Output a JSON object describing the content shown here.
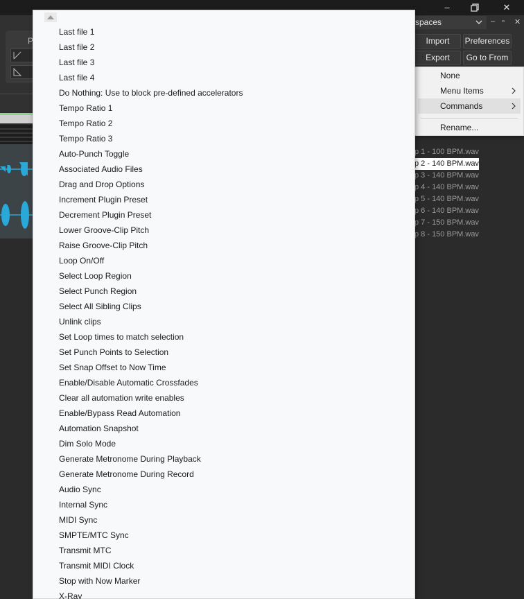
{
  "window": {
    "workspace_label": "spaces",
    "minimize_glyph": "–",
    "maximize_glyph": "❐",
    "close_glyph": "✕",
    "mini_controls": [
      "–",
      "▫",
      "✕"
    ]
  },
  "left_panel": {
    "label": "P"
  },
  "toolbar": {
    "import_label": "Import",
    "preferences_label": "Preferences",
    "export_label": "Export",
    "goto_label": "Go to From"
  },
  "files": [
    {
      "label": "p 1 - 100 BPM.wav",
      "selected": false
    },
    {
      "label": "p 2 - 140 BPM.wav",
      "selected": true
    },
    {
      "label": "p 3 - 140 BPM.wav",
      "selected": false
    },
    {
      "label": "p 4 - 140 BPM.wav",
      "selected": false
    },
    {
      "label": "p 5 - 140 BPM.wav",
      "selected": false
    },
    {
      "label": "p 6 - 140 BPM.wav",
      "selected": false
    },
    {
      "label": "p 7 - 150 BPM.wav",
      "selected": false
    },
    {
      "label": "p 8 - 150 BPM.wav",
      "selected": false
    }
  ],
  "submenu": {
    "items": [
      {
        "label": "None",
        "has_arrow": false,
        "highlighted": false
      },
      {
        "label": "Menu Items",
        "has_arrow": true,
        "highlighted": false
      },
      {
        "label": "Commands",
        "has_arrow": true,
        "highlighted": true
      }
    ],
    "rename_label": "Rename..."
  },
  "menu": {
    "scroll_icon": "scroll-up-arrow",
    "items": [
      "Last file 1",
      "Last file 2",
      "Last file 3",
      "Last file 4",
      "Do Nothing: Use to block pre-defined accelerators",
      "Tempo Ratio 1",
      "Tempo Ratio 2",
      "Tempo Ratio 3",
      "Auto-Punch Toggle",
      "Associated Audio Files",
      "Drag and Drop Options",
      "Increment Plugin Preset",
      "Decrement Plugin Preset",
      "Lower Groove-Clip Pitch",
      "Raise Groove-Clip Pitch",
      "Loop On/Off",
      "Select Loop Region",
      "Select Punch Region",
      "Select All Sibling Clips",
      "Unlink clips",
      "Set Loop times to match selection",
      "Set Punch Points to Selection",
      "Set Snap Offset to Now Time",
      "Enable/Disable Automatic Crossfades",
      "Clear all automation write enables",
      "Enable/Bypass Read Automation",
      "Automation Snapshot",
      "Dim Solo Mode",
      "Generate Metronome During Playback",
      "Generate Metronome During Record",
      "Audio Sync",
      "Internal Sync",
      "MIDI Sync",
      "SMPTE/MTC Sync",
      "Transmit MTC",
      "Transmit MIDI Clock",
      "Stop with Now Marker",
      "X-Ray"
    ]
  },
  "colors": {
    "waveform": "#2aa8d8",
    "menu_bg": "#f8f9fa",
    "app_bg": "#2b2b2b"
  }
}
